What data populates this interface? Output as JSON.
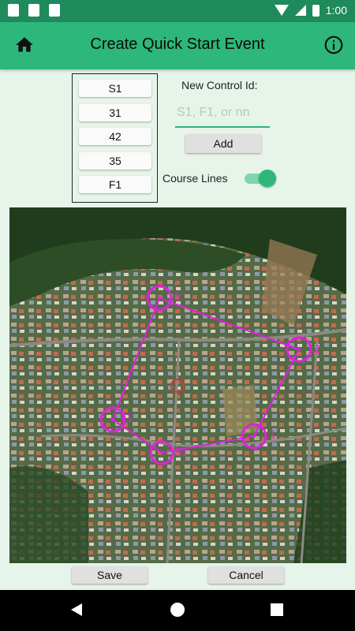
{
  "status_bar": {
    "time": "1:00"
  },
  "app_bar": {
    "title": "Create Quick Start Event",
    "home_icon": "home-icon",
    "info_icon": "info-icon"
  },
  "controls": {
    "items": [
      "S1",
      "31",
      "42",
      "35",
      "F1"
    ]
  },
  "new_control": {
    "label": "New Control Id:",
    "placeholder": "S1, F1, or nn",
    "value": "",
    "add_label": "Add"
  },
  "course_lines": {
    "label": "Course Lines",
    "enabled": true
  },
  "map": {
    "markers": [
      {
        "label": "3",
        "color": "#e020e0"
      },
      {
        "label": "2",
        "color": "#e020e0"
      },
      {
        "label": "1",
        "color": "#e020e0"
      },
      {
        "label": "S1",
        "color": "#e020e0"
      },
      {
        "label": "F1",
        "color": "#e020e0"
      }
    ],
    "route_color": "#e020e0",
    "location_color": "#e03030"
  },
  "actions": {
    "save_label": "Save",
    "cancel_label": "Cancel"
  },
  "colors": {
    "accent": "#2db77a",
    "status_bar": "#1f8a5b",
    "background": "#e6f4ea"
  }
}
